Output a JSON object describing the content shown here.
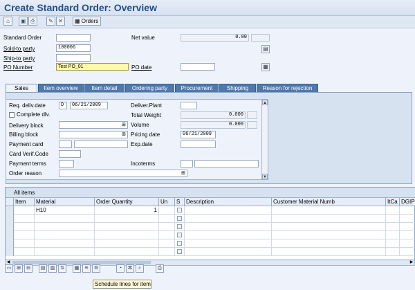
{
  "window": {
    "title": "Create Standard Order: Overview"
  },
  "toolbar": {
    "buttons": [
      {
        "icon": "display-doc-flow-icon"
      },
      {
        "icon": "copy-icon"
      },
      {
        "icon": "print-icon"
      },
      {
        "icon": "change-icon"
      },
      {
        "icon": "orders-icon",
        "label": "Orders"
      }
    ]
  },
  "header": {
    "standard_order_label": "Standard Order",
    "standard_order_value": "",
    "net_value_label": "Net value",
    "net_value_value": "0.00",
    "sold_to_party_label": "Sold-to party",
    "sold_to_party_value": "100006",
    "ship_to_party_label": "Ship-to party",
    "ship_to_party_value": "",
    "po_number_label": "PO Number",
    "po_number_value": "Test PO_01",
    "po_date_label": "PO date",
    "po_date_value": ""
  },
  "tabs": [
    {
      "label": "Sales",
      "active": true
    },
    {
      "label": "Item overview"
    },
    {
      "label": "Item detail"
    },
    {
      "label": "Ordering party"
    },
    {
      "label": "Procurement"
    },
    {
      "label": "Shipping"
    },
    {
      "label": "Reason for rejection"
    }
  ],
  "sales": {
    "req_deliv_date_label": "Req. deliv.date",
    "req_deliv_date_unit": "D",
    "req_deliv_date_value": "06/21/2009",
    "deliver_plant_label": "Deliver.Plant",
    "deliver_plant_value": "",
    "complete_dlv_label": "Complete dlv.",
    "total_weight_label": "Total Weight",
    "total_weight_value": "0.000",
    "delivery_block_label": "Delivery block",
    "delivery_block_value": "",
    "volume_label": "Volume",
    "volume_value": "0.000",
    "billing_block_label": "Billing block",
    "billing_block_value": "",
    "pricing_date_label": "Pricing date",
    "pricing_date_value": "06/21/2009",
    "payment_card_label": "Payment card",
    "payment_card_value": "",
    "payment_card_extra_value": "",
    "exp_date_label": "Exp.date",
    "exp_date_value": "",
    "card_verif_code_label": "Card Verif.Code",
    "card_verif_code_value": "",
    "payment_terms_label": "Payment terms",
    "payment_terms_value": "",
    "incoterms_label": "Incoterms",
    "incoterms_value": "",
    "incoterms_location_value": "",
    "order_reason_label": "Order reason",
    "order_reason_value": ""
  },
  "items_table": {
    "title": "All items",
    "columns": [
      "Item",
      "Material",
      "Order Quantity",
      "Un",
      "S",
      "Description",
      "Customer Material Numb",
      "ItCa",
      "DGIP"
    ],
    "rows": [
      {
        "item": "",
        "material": "H10",
        "order_quantity": "1",
        "un": "",
        "s": "",
        "description": "",
        "customer_material_numb": "",
        "itca": "",
        "dgip": ""
      },
      {
        "item": "",
        "material": "",
        "order_quantity": "",
        "un": "",
        "s": "",
        "description": "",
        "customer_material_numb": "",
        "itca": "",
        "dgip": ""
      },
      {
        "item": "",
        "material": "",
        "order_quantity": "",
        "un": "",
        "s": "",
        "description": "",
        "customer_material_numb": "",
        "itca": "",
        "dgip": ""
      },
      {
        "item": "",
        "material": "",
        "order_quantity": "",
        "un": "",
        "s": "",
        "description": "",
        "customer_material_numb": "",
        "itca": "",
        "dgip": ""
      },
      {
        "item": "",
        "material": "",
        "order_quantity": "",
        "un": "",
        "s": "",
        "description": "",
        "customer_material_numb": "",
        "itca": "",
        "dgip": ""
      },
      {
        "item": "",
        "material": "",
        "order_quantity": "",
        "un": "",
        "s": "",
        "description": "",
        "customer_material_numb": "",
        "itca": "",
        "dgip": ""
      }
    ]
  },
  "tooltip": {
    "text": "Schedule lines for item"
  }
}
